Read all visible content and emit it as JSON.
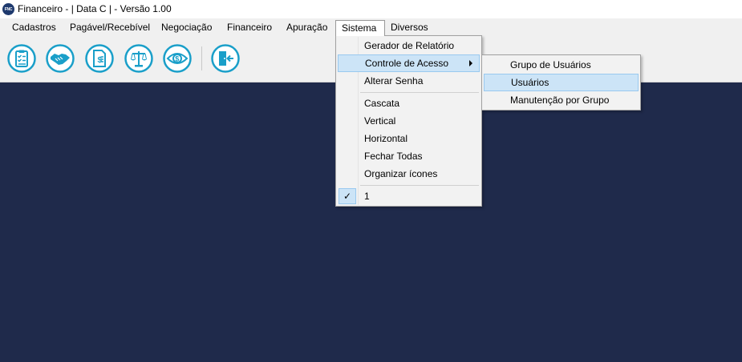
{
  "window": {
    "icon_text": "FNC",
    "title": "Financeiro - | Data C | - Versão 1.00"
  },
  "menubar": {
    "items": [
      {
        "label": "Cadastros"
      },
      {
        "label": "Pagável/Recebível"
      },
      {
        "label": "Negociação"
      },
      {
        "label": "Financeiro"
      },
      {
        "label": "Apuração"
      },
      {
        "label": "Sistema"
      },
      {
        "label": "Diversos"
      }
    ],
    "active": "Sistema"
  },
  "toolbar": {
    "buttons": [
      {
        "icon": "clipboard-checklist-icon"
      },
      {
        "icon": "handshake-icon"
      },
      {
        "icon": "invoice-dollar-icon"
      },
      {
        "icon": "balance-scale-icon"
      },
      {
        "icon": "money-eye-icon"
      },
      {
        "icon": "exit-door-icon"
      }
    ],
    "accent_color": "#1a9fc9"
  },
  "sistema_menu": {
    "items": [
      {
        "label": "Gerador de Relatório"
      },
      {
        "label": "Controle de Acesso"
      },
      {
        "label": "Alterar Senha"
      },
      {
        "label": "Cascata"
      },
      {
        "label": "Vertical"
      },
      {
        "label": "Horizontal"
      },
      {
        "label": "Fechar Todas"
      },
      {
        "label": "Organizar ícones"
      },
      {
        "label": "1",
        "checked": true
      }
    ],
    "highlighted": "Controle de Acesso"
  },
  "controle_submenu": {
    "items": [
      {
        "label": "Grupo de Usuários"
      },
      {
        "label": "Usuários"
      },
      {
        "label": "Manutenção por Grupo"
      }
    ],
    "highlighted": "Usuários"
  },
  "workspace": {
    "background": "#1f2a4b"
  }
}
